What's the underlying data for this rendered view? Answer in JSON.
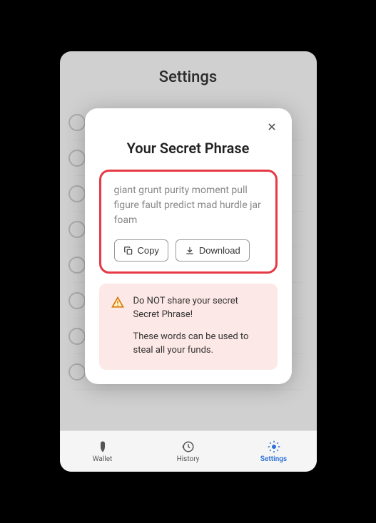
{
  "header": {
    "title": "Settings"
  },
  "modal": {
    "title": "Your Secret Phrase",
    "phrase": "giant grunt purity moment pull figure fault predict mad hurdle jar foam",
    "copy_label": "Copy",
    "download_label": "Download"
  },
  "warning": {
    "line1": "Do NOT share your secret Secret Phrase!",
    "line2": "These words can be used to steal all your funds."
  },
  "nav": {
    "wallet": "Wallet",
    "history": "History",
    "settings": "Settings"
  }
}
